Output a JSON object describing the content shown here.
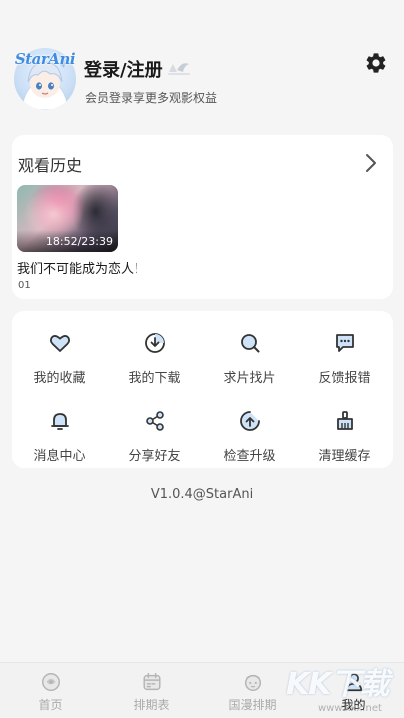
{
  "profile": {
    "avatar_logo": "StarAni",
    "login_title": "登录/注册",
    "login_subtitle": "会员登录享更多观影权益",
    "settings_icon": "gear-icon"
  },
  "history": {
    "title": "观看历史",
    "arrow_icon": "chevron-right-icon",
    "items": [
      {
        "time": "18:52/23:39",
        "title": "我们不可能成为恋人！绝对不行。（※似乎可以？）",
        "episode": "01"
      }
    ]
  },
  "functions": [
    {
      "label": "我的收藏",
      "icon": "heart-icon"
    },
    {
      "label": "我的下载",
      "icon": "download-icon"
    },
    {
      "label": "求片找片",
      "icon": "search-icon"
    },
    {
      "label": "反馈报错",
      "icon": "feedback-icon"
    },
    {
      "label": "消息中心",
      "icon": "bell-icon"
    },
    {
      "label": "分享好友",
      "icon": "share-icon"
    },
    {
      "label": "检查升级",
      "icon": "upgrade-icon"
    },
    {
      "label": "清理缓存",
      "icon": "broom-icon"
    }
  ],
  "version": "V1.0.4@StarAni",
  "nav": {
    "items": [
      {
        "label": "首页",
        "icon": "home-icon",
        "active": false
      },
      {
        "label": "排期表",
        "icon": "calendar-icon",
        "active": false
      },
      {
        "label": "国漫排期",
        "icon": "guoman-icon",
        "active": false
      },
      {
        "label": "我的",
        "icon": "profile-icon",
        "active": true
      }
    ]
  },
  "watermark": {
    "text": "KK下载",
    "url": "www.kkx.net"
  },
  "colors": {
    "accent": "#4a90e2",
    "active_nav": "#222222",
    "inactive_nav": "#aaaaaa"
  }
}
